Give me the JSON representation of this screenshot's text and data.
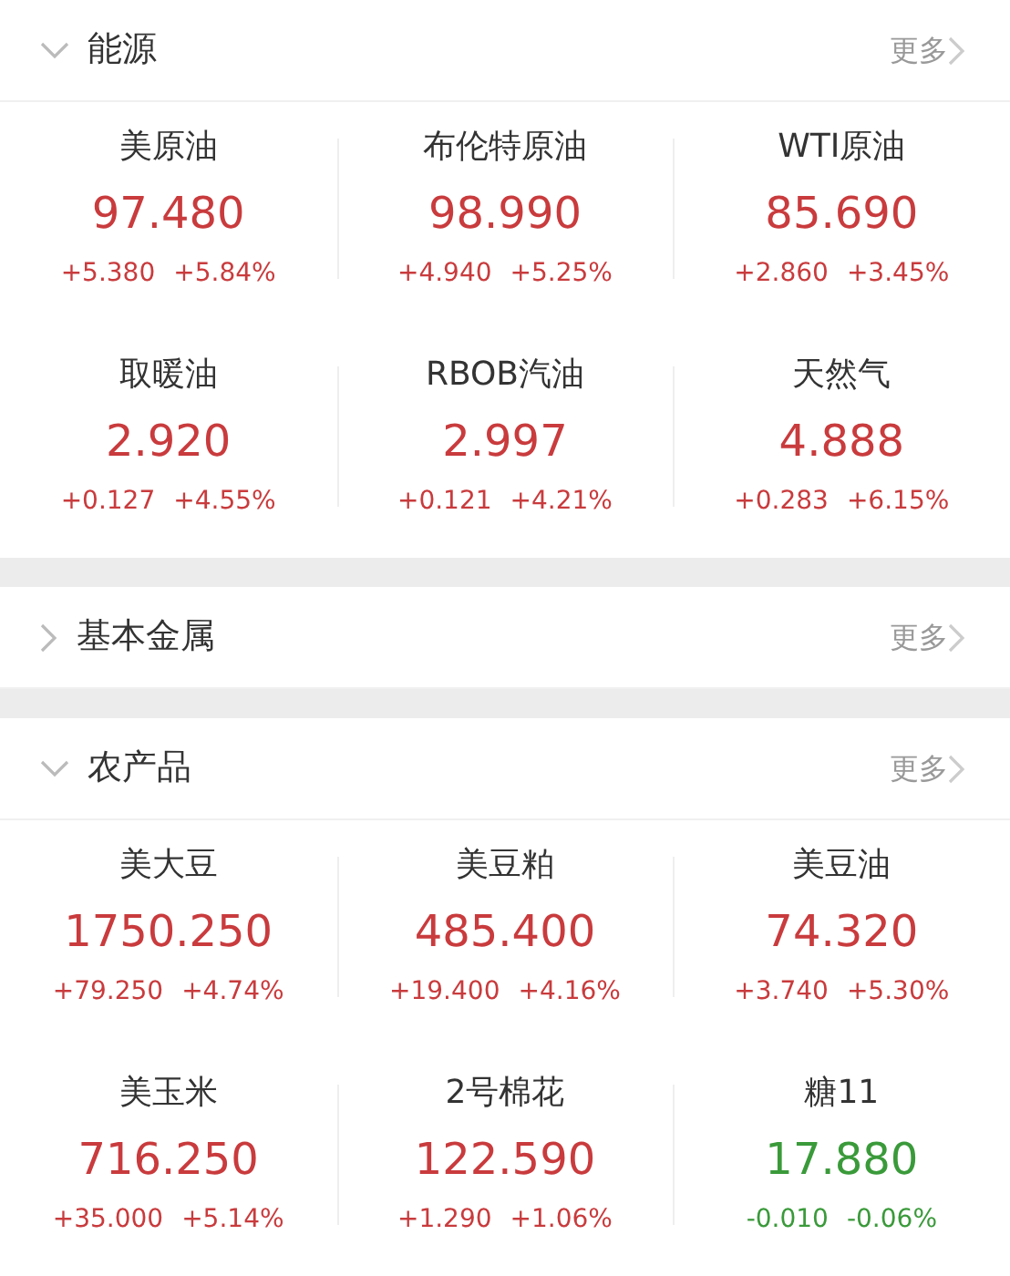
{
  "sections": [
    {
      "title": "能源",
      "expanded": true,
      "more": "更多",
      "items": [
        {
          "name": "美原油",
          "price": "97.480",
          "change": "+5.380",
          "percent": "+5.84%",
          "color": "#c93b3d"
        },
        {
          "name": "布伦特原油",
          "price": "98.990",
          "change": "+4.940",
          "percent": "+5.25%",
          "color": "#c93b3d"
        },
        {
          "name": "WTI原油",
          "price": "85.690",
          "change": "+2.860",
          "percent": "+3.45%",
          "color": "#c93b3d"
        },
        {
          "name": "取暖油",
          "price": "2.920",
          "change": "+0.127",
          "percent": "+4.55%",
          "color": "#c93b3d"
        },
        {
          "name": "RBOB汽油",
          "price": "2.997",
          "change": "+0.121",
          "percent": "+4.21%",
          "color": "#c93b3d"
        },
        {
          "name": "天然气",
          "price": "4.888",
          "change": "+0.283",
          "percent": "+6.15%",
          "color": "#c93b3d"
        }
      ]
    },
    {
      "title": "基本金属",
      "expanded": false,
      "more": "更多"
    },
    {
      "title": "农产品",
      "expanded": true,
      "more": "更多",
      "items": [
        {
          "name": "美大豆",
          "price": "1750.250",
          "change": "+79.250",
          "percent": "+4.74%",
          "color": "#c93b3d"
        },
        {
          "name": "美豆粕",
          "price": "485.400",
          "change": "+19.400",
          "percent": "+4.16%",
          "color": "#c93b3d"
        },
        {
          "name": "美豆油",
          "price": "74.320",
          "change": "+3.740",
          "percent": "+5.30%",
          "color": "#c93b3d"
        },
        {
          "name": "美玉米",
          "price": "716.250",
          "change": "+35.000",
          "percent": "+5.14%",
          "color": "#c93b3d"
        },
        {
          "name": "2号棉花",
          "price": "122.590",
          "change": "+1.290",
          "percent": "+1.06%",
          "color": "#c93b3d"
        },
        {
          "name": "糖11",
          "price": "17.880",
          "change": "-0.010",
          "percent": "-0.06%",
          "color": "#3a9a3a"
        }
      ]
    }
  ]
}
